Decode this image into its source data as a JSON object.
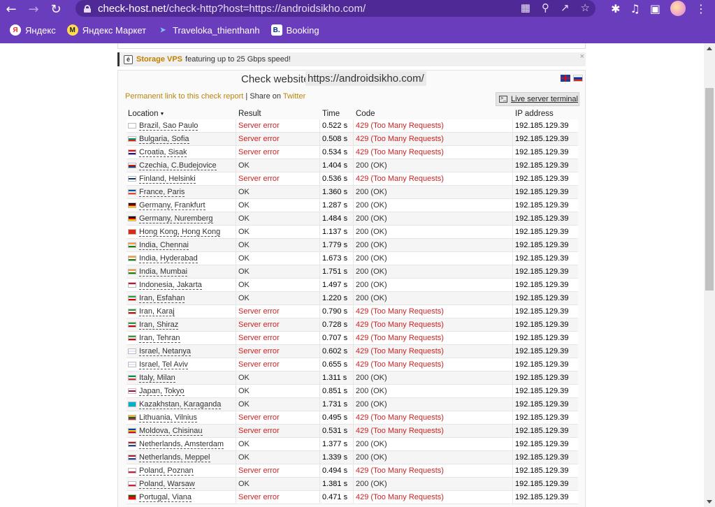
{
  "browser": {
    "url_host": "check-host.net",
    "url_path": "/check-http?host=https://androidsikho.com/",
    "bookmarks": [
      {
        "label": "Яндекс",
        "icon": "yandex-icon"
      },
      {
        "label": "Яндекс Маркет",
        "icon": "yandex-market-icon"
      },
      {
        "label": "Traveloka_thienthanh",
        "icon": "traveloka-icon"
      },
      {
        "label": "Booking",
        "icon": "booking-icon"
      }
    ]
  },
  "ad": {
    "brand": "Storage VPS",
    "text": "featuring up to 25 Gbps speed!",
    "close": "×"
  },
  "check": {
    "title": "Check website",
    "url": "https://androidsikho.com/",
    "permalink_label": "Permanent link to this check report",
    "separator": "|",
    "share_prefix": "Share on",
    "share_target": "Twitter",
    "terminal_label": "Live server terminal"
  },
  "table": {
    "headers": {
      "location": "Location",
      "result": "Result",
      "time": "Time",
      "code": "Code",
      "ip": "IP address"
    },
    "rows": [
      {
        "location": "Brazil, Sao Paulo",
        "flag": [
          "#2a9d3f",
          "#f5d90a"
        ],
        "result": "Server error",
        "time": "0.522 s",
        "code": "429 (Too Many Requests)",
        "ip": "192.185.129.39",
        "error": true
      },
      {
        "location": "Bulgaria, Sofia",
        "flag": [
          "#fff",
          "#00966e",
          "#d62612"
        ],
        "result": "Server error",
        "time": "0.508 s",
        "code": "429 (Too Many Requests)",
        "ip": "192.185.129.39",
        "error": true
      },
      {
        "location": "Croatia, Sisak",
        "flag": [
          "#ff0000",
          "#fff",
          "#171796"
        ],
        "result": "Server error",
        "time": "0.534 s",
        "code": "429 (Too Many Requests)",
        "ip": "192.185.129.39",
        "error": true
      },
      {
        "location": "Czechia, C.Budejovice",
        "flag": [
          "#fff",
          "#d7141a",
          "#11457e"
        ],
        "result": "OK",
        "time": "1.404 s",
        "code": "200 (OK)",
        "ip": "192.185.129.39",
        "error": false
      },
      {
        "location": "Finland, Helsinki",
        "flag": [
          "#fff",
          "#003580",
          "#fff"
        ],
        "result": "Server error",
        "time": "0.536 s",
        "code": "429 (Too Many Requests)",
        "ip": "192.185.129.39",
        "error": true
      },
      {
        "location": "France, Paris",
        "flag": [
          "#0055a4",
          "#fff",
          "#ef4135"
        ],
        "result": "OK",
        "time": "1.360 s",
        "code": "200 (OK)",
        "ip": "192.185.129.39",
        "error": false
      },
      {
        "location": "Germany, Frankfurt",
        "flag": [
          "#000",
          "#dd0000",
          "#ffce00"
        ],
        "result": "OK",
        "time": "1.287 s",
        "code": "200 (OK)",
        "ip": "192.185.129.39",
        "error": false
      },
      {
        "location": "Germany, Nuremberg",
        "flag": [
          "#000",
          "#dd0000",
          "#ffce00"
        ],
        "result": "OK",
        "time": "1.484 s",
        "code": "200 (OK)",
        "ip": "192.185.129.39",
        "error": false
      },
      {
        "location": "Hong Kong, Hong Kong",
        "flag": [
          "#de2910",
          "#de2910",
          "#de2910"
        ],
        "result": "OK",
        "time": "1.137 s",
        "code": "200 (OK)",
        "ip": "192.185.129.39",
        "error": false
      },
      {
        "location": "India, Chennai",
        "flag": [
          "#ff9933",
          "#fff",
          "#138808"
        ],
        "result": "OK",
        "time": "1.779 s",
        "code": "200 (OK)",
        "ip": "192.185.129.39",
        "error": false
      },
      {
        "location": "India, Hyderabad",
        "flag": [
          "#ff9933",
          "#fff",
          "#138808"
        ],
        "result": "OK",
        "time": "1.673 s",
        "code": "200 (OK)",
        "ip": "192.185.129.39",
        "error": false
      },
      {
        "location": "India, Mumbai",
        "flag": [
          "#ff9933",
          "#fff",
          "#138808"
        ],
        "result": "OK",
        "time": "1.751 s",
        "code": "200 (OK)",
        "ip": "192.185.129.39",
        "error": false
      },
      {
        "location": "Indonesia, Jakarta",
        "flag": [
          "#ce1126",
          "#fff",
          "#fff"
        ],
        "result": "OK",
        "time": "1.497 s",
        "code": "200 (OK)",
        "ip": "192.185.129.39",
        "error": false
      },
      {
        "location": "Iran, Esfahan",
        "flag": [
          "#239f40",
          "#fff",
          "#da0000"
        ],
        "result": "OK",
        "time": "1.220 s",
        "code": "200 (OK)",
        "ip": "192.185.129.39",
        "error": false
      },
      {
        "location": "Iran, Karaj",
        "flag": [
          "#239f40",
          "#fff",
          "#da0000"
        ],
        "result": "Server error",
        "time": "0.790 s",
        "code": "429 (Too Many Requests)",
        "ip": "192.185.129.39",
        "error": true
      },
      {
        "location": "Iran, Shiraz",
        "flag": [
          "#239f40",
          "#fff",
          "#da0000"
        ],
        "result": "Server error",
        "time": "0.728 s",
        "code": "429 (Too Many Requests)",
        "ip": "192.185.129.39",
        "error": true
      },
      {
        "location": "Iran, Tehran",
        "flag": [
          "#239f40",
          "#fff",
          "#da0000"
        ],
        "result": "Server error",
        "time": "0.707 s",
        "code": "429 (Too Many Requests)",
        "ip": "192.185.129.39",
        "error": true
      },
      {
        "location": "Israel, Netanya",
        "flag": [
          "#fff",
          "#dbe6ff",
          "#fff"
        ],
        "result": "Server error",
        "time": "0.602 s",
        "code": "429 (Too Many Requests)",
        "ip": "192.185.129.39",
        "error": true
      },
      {
        "location": "Israel, Tel Aviv",
        "flag": [
          "#fff",
          "#dbe6ff",
          "#fff"
        ],
        "result": "Server error",
        "time": "0.655 s",
        "code": "429 (Too Many Requests)",
        "ip": "192.185.129.39",
        "error": true
      },
      {
        "location": "Italy, Milan",
        "flag": [
          "#009246",
          "#fff",
          "#ce2b37"
        ],
        "result": "OK",
        "time": "1.311 s",
        "code": "200 (OK)",
        "ip": "192.185.129.39",
        "error": false
      },
      {
        "location": "Japan, Tokyo",
        "flag": [
          "#fff",
          "#bc002d",
          "#fff"
        ],
        "result": "OK",
        "time": "0.851 s",
        "code": "200 (OK)",
        "ip": "192.185.129.39",
        "error": false
      },
      {
        "location": "Kazakhstan, Karaganda",
        "flag": [
          "#00afca",
          "#00afca",
          "#00afca"
        ],
        "result": "OK",
        "time": "1.731 s",
        "code": "200 (OK)",
        "ip": "192.185.129.39",
        "error": false
      },
      {
        "location": "Lithuania, Vilnius",
        "flag": [
          "#fdb913",
          "#006a44",
          "#c1272d"
        ],
        "result": "Server error",
        "time": "0.495 s",
        "code": "429 (Too Many Requests)",
        "ip": "192.185.129.39",
        "error": true
      },
      {
        "location": "Moldova, Chisinau",
        "flag": [
          "#0046ae",
          "#ffd200",
          "#cc092f"
        ],
        "result": "Server error",
        "time": "0.531 s",
        "code": "429 (Too Many Requests)",
        "ip": "192.185.129.39",
        "error": true
      },
      {
        "location": "Netherlands, Amsterdam",
        "flag": [
          "#ae1c28",
          "#fff",
          "#21468b"
        ],
        "result": "OK",
        "time": "1.377 s",
        "code": "200 (OK)",
        "ip": "192.185.129.39",
        "error": false
      },
      {
        "location": "Netherlands, Meppel",
        "flag": [
          "#ae1c28",
          "#fff",
          "#21468b"
        ],
        "result": "OK",
        "time": "1.339 s",
        "code": "200 (OK)",
        "ip": "192.185.129.39",
        "error": false
      },
      {
        "location": "Poland, Poznan",
        "flag": [
          "#fff",
          "#fff",
          "#dc143c"
        ],
        "result": "Server error",
        "time": "0.494 s",
        "code": "429 (Too Many Requests)",
        "ip": "192.185.129.39",
        "error": true
      },
      {
        "location": "Poland, Warsaw",
        "flag": [
          "#fff",
          "#fff",
          "#dc143c"
        ],
        "result": "OK",
        "time": "1.381 s",
        "code": "200 (OK)",
        "ip": "192.185.129.39",
        "error": false
      },
      {
        "location": "Portugal, Viana",
        "flag": [
          "#006600",
          "#ff0000",
          "#ff0000"
        ],
        "result": "Server error",
        "time": "0.471 s",
        "code": "429 (Too Many Requests)",
        "ip": "192.185.129.39",
        "error": true
      }
    ]
  },
  "colors": {
    "chrome": "#6a3dbd",
    "error": "#cc2222",
    "link": "#b8860b"
  }
}
